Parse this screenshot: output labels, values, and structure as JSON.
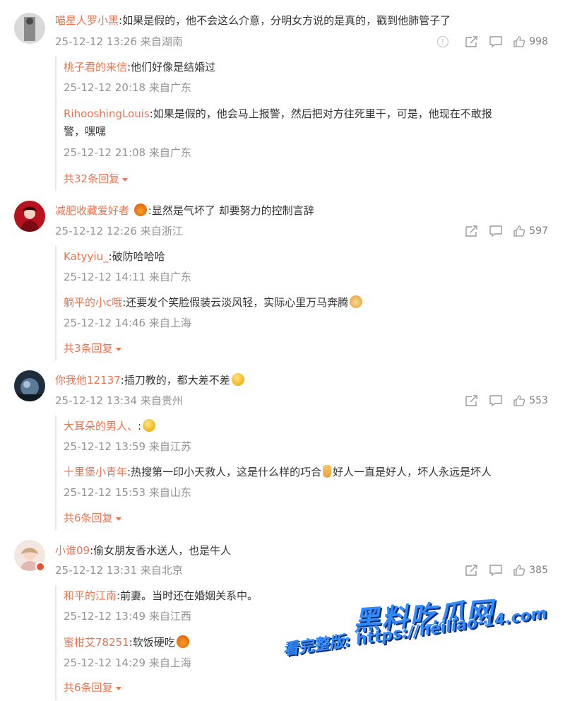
{
  "comments": [
    {
      "user": "喵星人罗小黑",
      "text": ":如果是假的，他不会这么介意，分明女方说的是真的，戳到他肺管子了",
      "meta": "25-12-12 13:26 来自湖南",
      "likes": "998",
      "has_info": true,
      "replies": [
        {
          "user": "桃子君的来信",
          "text": ":他们好像是结婚过",
          "meta": "25-12-12 20:18 来自广东"
        },
        {
          "user": "RihooshingLouis",
          "text": ":如果是假的，他会马上报警，然后把对方往死里干，可是，他现在不敢报",
          "text2": "警，嘿嘿",
          "meta": "25-12-12 21:08 来自广东"
        }
      ],
      "more": "共32条回复"
    },
    {
      "user": "减肥收藏爱好者",
      "text": ":显然是气坏了 却要努力的控制言辞",
      "meta": "25-12-12 12:26 来自浙江",
      "likes": "597",
      "replies": [
        {
          "user": "Katyyiu_",
          "text": ":破防哈哈哈",
          "meta": "25-12-12 14:11 来自广东"
        },
        {
          "user": "躺平的小c哦",
          "text": ":还要发个笑脸假装云淡风轻，实际心里万马奔腾",
          "meta": "25-12-12 14:46 来自上海"
        }
      ],
      "more": "共3条回复"
    },
    {
      "user": "你我他12137",
      "text": ":插刀教的，都大差不差",
      "meta": "25-12-12 13:34 来自贵州",
      "likes": "553",
      "replies": [
        {
          "user": "大耳朵的男人、",
          "text": ":",
          "meta": "25-12-12 13:59 来自江苏"
        },
        {
          "user": "十里堡小青年",
          "text": ":热搜第一印小天救人，这是什么样的巧合",
          "text_b": "好人一直是好人，坏人永远是坏人",
          "meta": "25-12-12 15:53 来自山东"
        }
      ],
      "more": "共6条回复"
    },
    {
      "user": "小谁09",
      "text": ":偷女朋友香水送人，也是牛人",
      "meta": "25-12-12 13:31 来自北京",
      "likes": "385",
      "replies": [
        {
          "user": "和平的江南",
          "text": ":前妻。当时还在婚姻关系中。",
          "meta": "25-12-12 13:49 来自江西"
        },
        {
          "user": "蜜柑艾78251",
          "text": ":软饭硬吃",
          "meta": "25-12-12 14:29 来自上海"
        }
      ],
      "more": "共6条回复"
    }
  ],
  "watermark": {
    "title": "黑料吃瓜网",
    "url": "看完整版: https://heiliao-14.com"
  },
  "colors": {
    "name": "#eb7350",
    "meta": "#939393",
    "text": "#333333"
  }
}
